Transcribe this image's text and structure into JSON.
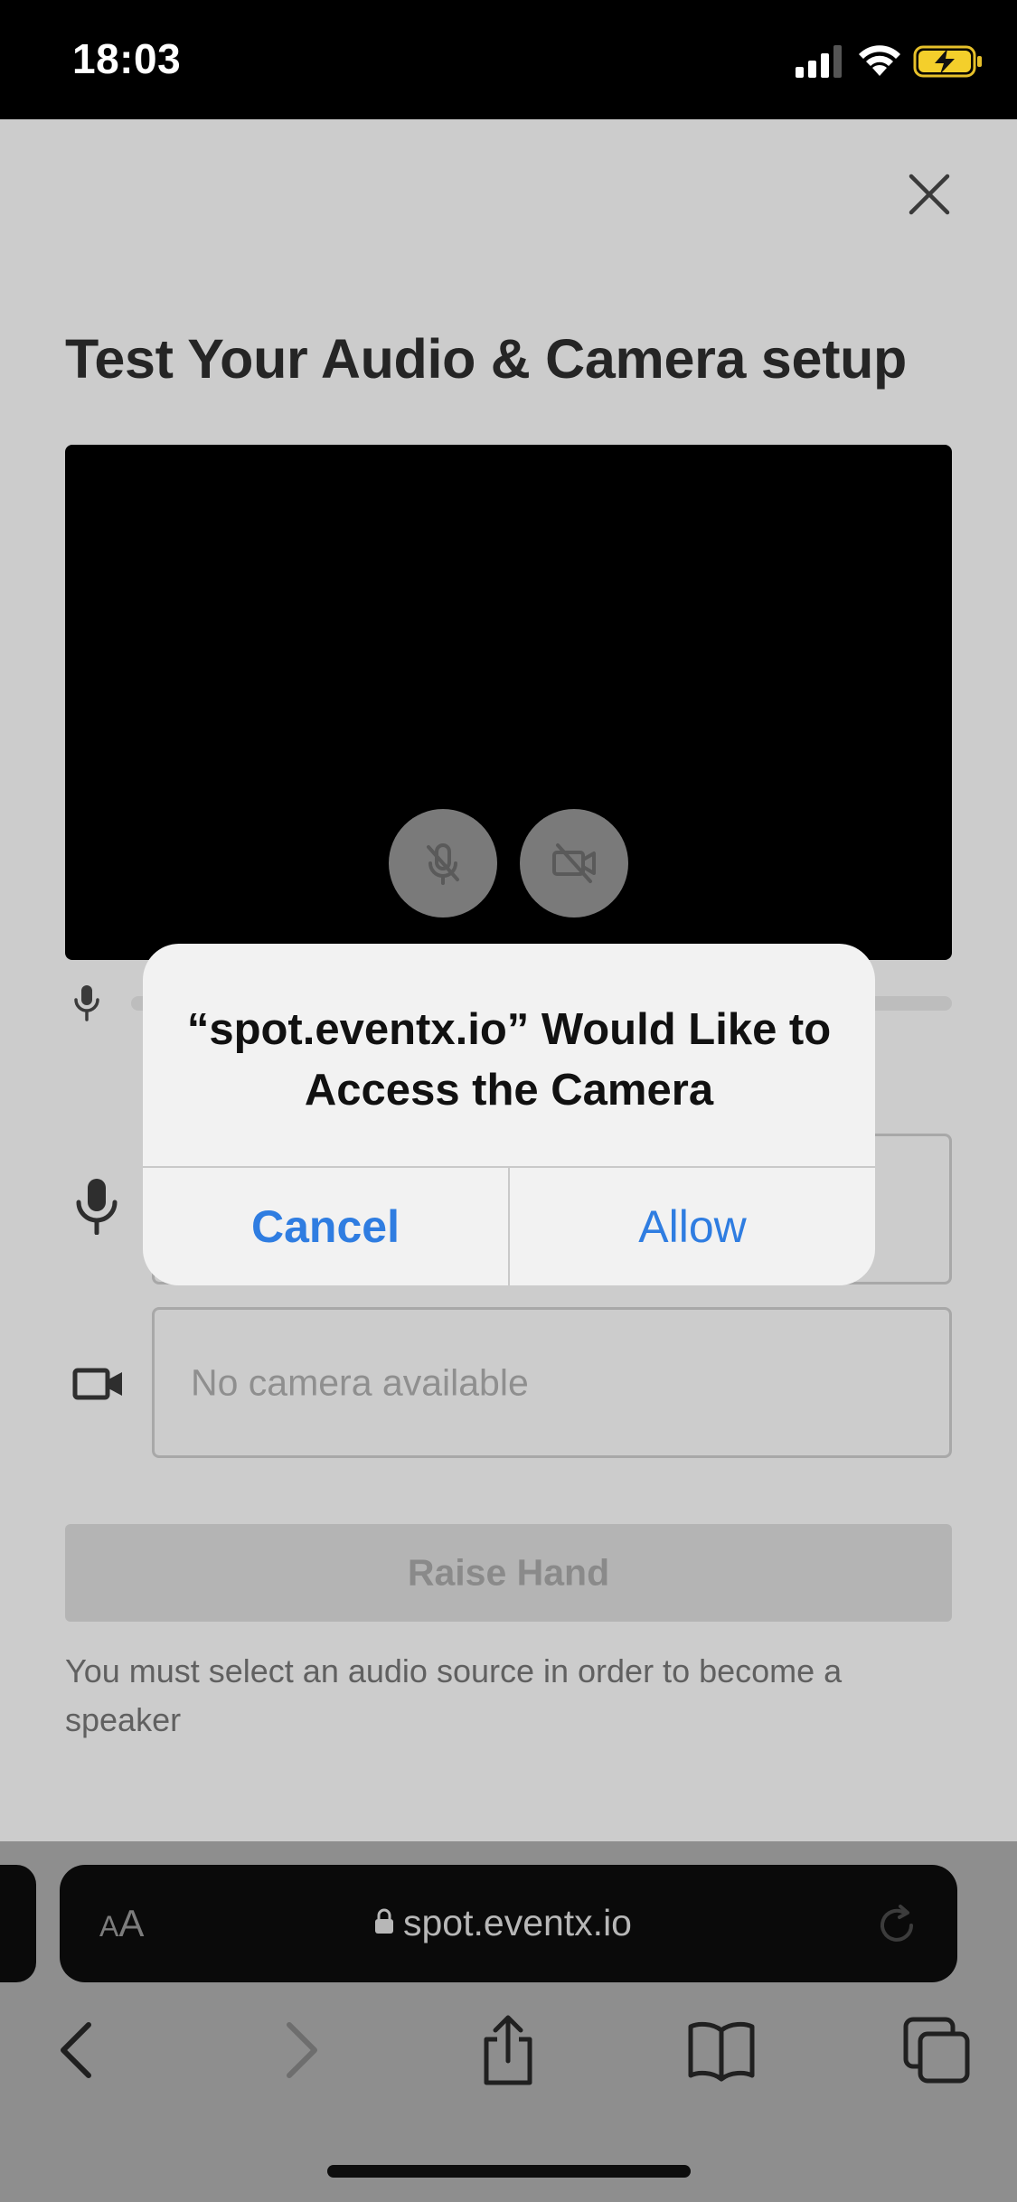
{
  "status_bar": {
    "time": "18:03"
  },
  "page": {
    "title": "Test Your Audio & Camera setup",
    "audio_device_placeholder": "",
    "camera_device_placeholder": "No camera available",
    "raise_hand_label": "Raise Hand",
    "hint": "You must select an audio source in order to become a speaker"
  },
  "dialog": {
    "title": "“spot.eventx.io” Would Like to Access the Camera",
    "cancel_label": "Cancel",
    "allow_label": "Allow"
  },
  "browser": {
    "aa_label_small": "A",
    "aa_label_large": "A",
    "url": "spot.eventx.io"
  }
}
